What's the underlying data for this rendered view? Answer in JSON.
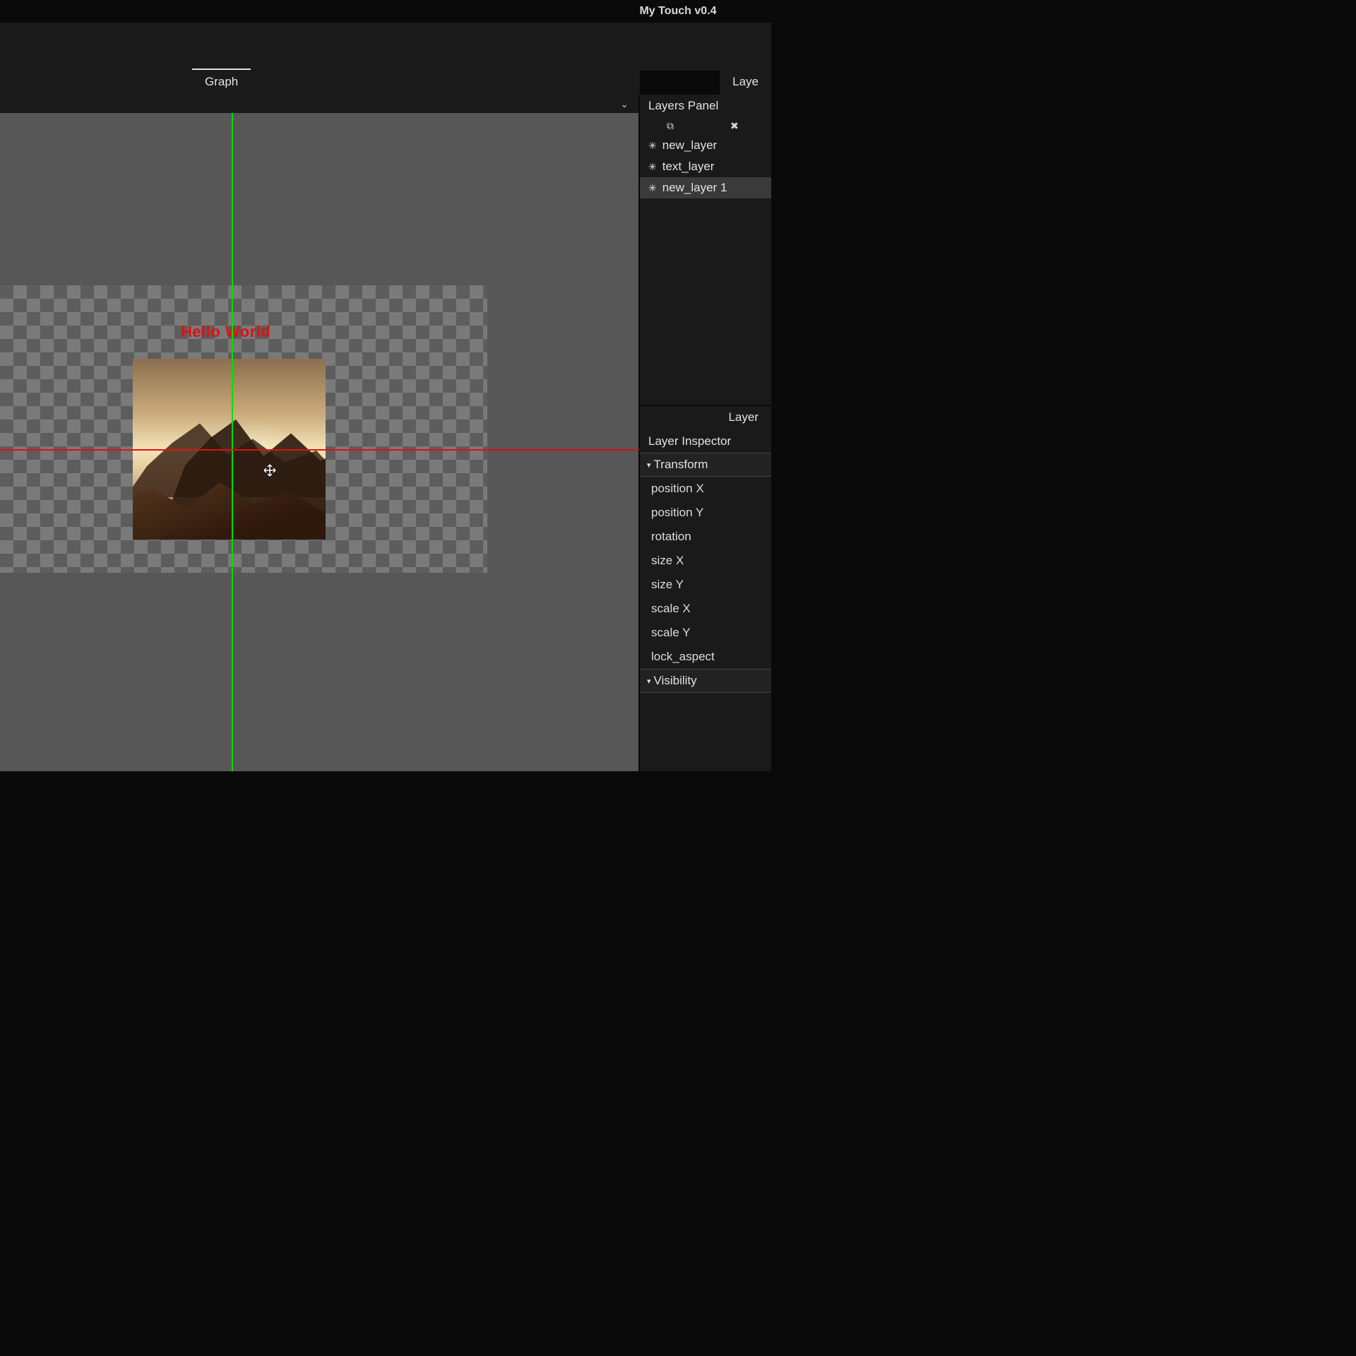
{
  "app": {
    "title": "My Touch v0.4"
  },
  "tabs": {
    "graph": "Graph",
    "layers_tab_truncated": "Laye",
    "layer_tab_truncated": "Layer"
  },
  "canvas": {
    "hello_text": "Hello World",
    "move_cursor": "move-cursor"
  },
  "layers_panel": {
    "title": "Layers Panel",
    "items": [
      {
        "label": "new_layer",
        "selected": false
      },
      {
        "label": "text_layer",
        "selected": false
      },
      {
        "label": "new_layer 1",
        "selected": true
      }
    ]
  },
  "inspector": {
    "title": "Layer Inspector",
    "groups": [
      {
        "label": "Transform",
        "props": [
          "position X",
          "position Y",
          "rotation",
          "size X",
          "size Y",
          "scale X",
          "scale Y",
          "lock_aspect"
        ]
      },
      {
        "label": "Visibility",
        "props": []
      }
    ]
  },
  "icons": {
    "chevron_down": "⌄",
    "copy": "⧉",
    "delete": "✖",
    "star": "✳",
    "caret": "▾"
  }
}
